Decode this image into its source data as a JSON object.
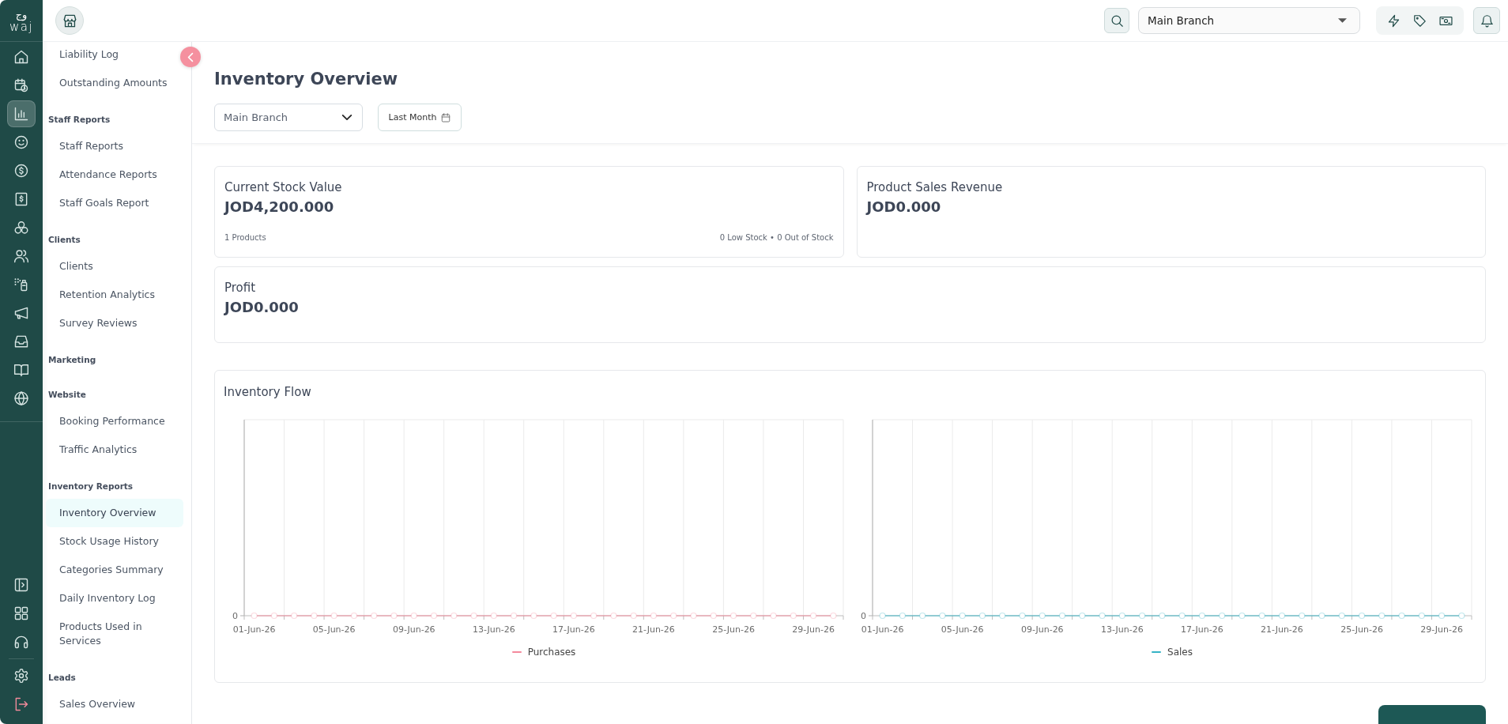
{
  "rail": {
    "logo": {
      "arabic": "وج",
      "latin": "waj"
    },
    "top_items": [
      {
        "selected": false
      },
      {
        "selected": false
      },
      {
        "selected": true
      },
      {
        "selected": false
      },
      {
        "selected": false
      },
      {
        "selected": false
      },
      {
        "selected": false
      },
      {
        "selected": false
      },
      {
        "selected": false
      },
      {
        "selected": false
      },
      {
        "selected": false
      },
      {
        "selected": false
      },
      {
        "selected": false
      }
    ],
    "bottom_items": [
      {
        "selected": false
      },
      {
        "selected": false
      },
      {
        "selected": false
      },
      {
        "selected": false
      },
      {
        "selected": false
      }
    ]
  },
  "header": {
    "branch_select": {
      "value": "Main Branch"
    }
  },
  "sidebar": {
    "sections": [
      {
        "items": [
          {
            "label": "Liability Log",
            "selected": false
          },
          {
            "label": "Outstanding Amounts",
            "selected": false
          }
        ]
      },
      {
        "heading": "Staff Reports",
        "items": [
          {
            "label": "Staff Reports",
            "selected": false
          },
          {
            "label": "Attendance Reports",
            "selected": false
          },
          {
            "label": "Staff Goals Report",
            "selected": false
          }
        ]
      },
      {
        "heading": "Clients",
        "items": [
          {
            "label": "Clients",
            "selected": false
          },
          {
            "label": "Retention Analytics",
            "selected": false
          },
          {
            "label": "Survey Reviews",
            "selected": false
          }
        ]
      },
      {
        "heading": "Marketing"
      },
      {
        "heading": "Website",
        "items": [
          {
            "label": "Booking Performance",
            "selected": false
          },
          {
            "label": "Traffic Analytics",
            "selected": false
          }
        ]
      },
      {
        "heading": "Inventory Reports",
        "items": [
          {
            "label": "Inventory Overview",
            "selected": true
          },
          {
            "label": "Stock Usage History",
            "selected": false
          },
          {
            "label": "Categories Summary",
            "selected": false
          },
          {
            "label": "Daily Inventory Log",
            "selected": false
          },
          {
            "label": "Products Used in Services",
            "selected": false
          }
        ]
      },
      {
        "heading": "Leads",
        "items": [
          {
            "label": "Sales Overview",
            "selected": false
          }
        ]
      }
    ]
  },
  "page": {
    "title": "Inventory Overview",
    "branch_filter": {
      "value": "Main Branch"
    },
    "period_button": {
      "label": "Last Month"
    }
  },
  "stats": [
    {
      "label": "Current Stock Value",
      "value": "JOD4,200.000",
      "footnote_left": "1 Products",
      "footnote_right": "0 Low Stock • 0 Out of Stock"
    },
    {
      "label": "Product Sales Revenue",
      "value": "JOD0.000"
    },
    {
      "label": "Profit",
      "value": "JOD0.000"
    }
  ],
  "inventory_flow": {
    "title": "Inventory Flow",
    "charts": [
      {
        "y_label": "0",
        "x_labels": [
          "01-Jun-26",
          "05-Jun-26",
          "09-Jun-26",
          "13-Jun-26",
          "17-Jun-26",
          "21-Jun-26",
          "25-Jun-26",
          "29-Jun-26"
        ],
        "legend": {
          "label": "Purchases",
          "color": "#f4899c"
        }
      },
      {
        "y_label": "0",
        "x_labels": [
          "01-Jun-26",
          "05-Jun-26",
          "09-Jun-26",
          "13-Jun-26",
          "17-Jun-26",
          "21-Jun-26",
          "25-Jun-26",
          "29-Jun-26"
        ],
        "legend": {
          "label": "Sales",
          "color": "#36b3c6"
        }
      }
    ]
  }
}
